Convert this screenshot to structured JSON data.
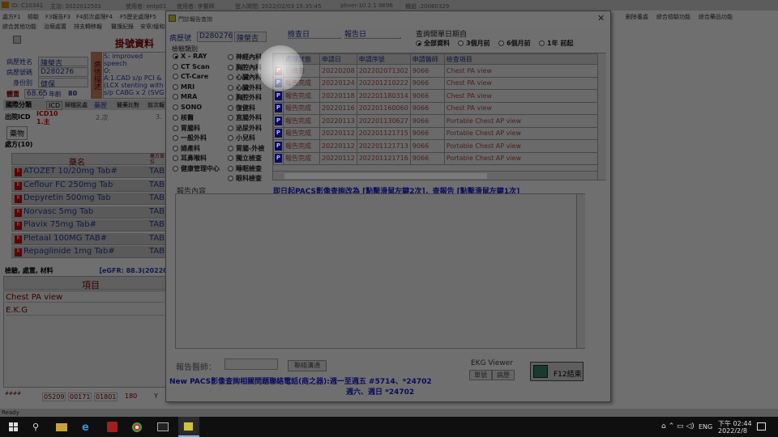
{
  "topbar": {
    "id": "ID: C10341",
    "date_label": "主治: 2022012501",
    "user": "使用者: entp01",
    "user2": "使用者: 李醫師",
    "login_time": "登入時間: 2022/02/03 15:35:45",
    "version": "pbver:10.2.1.9696",
    "machine": "機組 :20060329"
  },
  "menu": {
    "row1": [
      "處方F1",
      "檢驗",
      "F3報告F3",
      "F4前次處理F4",
      "F5歷史處理F5"
    ],
    "row1_right": [
      "刪除養處",
      "綜合檢驗功能",
      "綜合藥品功能"
    ],
    "row2": [
      "綜合其他功能",
      "治療處置",
      "排支轉移報",
      "醫護紀錄",
      "安寧/緩和"
    ]
  },
  "left": {
    "header": "掛號資料",
    "name_label": "病歷姓名",
    "name_value": "陳榮吉",
    "chart_label": "病歷號碼",
    "chart_value": "D280276",
    "id_label": "身份別",
    "id_value": "健保",
    "weight_label": "體重",
    "weight_value": "68.65",
    "age_label": "年齡",
    "age_value": "80",
    "diag_label": "病情描述",
    "diag_lines": [
      "S: improved speech",
      "O:",
      "A:1.CAD s/p PCI &",
      "(LCX stenting with",
      "s/p CABG x 2 (SVG"
    ],
    "tabs": [
      "國際分類",
      "ICD",
      "歸檔民處",
      "藥歷",
      "醫藥比對",
      "前次報"
    ],
    "icd_label": "出院ICD",
    "icd10": "ICD10",
    "icd_sub": "1.主",
    "icd_sub2": "2.次",
    "icd_sub3": "3.",
    "drug_tab": "藥物",
    "rx_title": "處方(10)",
    "drug_col": "藥名",
    "unit_col": "藥方單位",
    "drugs": [
      {
        "name": "ATOZET 10/20mg Tab#",
        "unit": "TAB"
      },
      {
        "name": "Ceflour FC 250mg Tab",
        "unit": "TAB"
      },
      {
        "name": "Depyretin 500mg Tab",
        "unit": "TAB"
      },
      {
        "name": "Norvasc 5mg Tab",
        "unit": "TAB"
      },
      {
        "name": "Plavix 75mg Tab#",
        "unit": "TAB"
      },
      {
        "name": "Pletaal 100MG TAB#",
        "unit": "TAB"
      },
      {
        "name": "Repaglinide 1mg Tab#",
        "unit": "TAB"
      }
    ],
    "exam_title": "檢驗, 處置, 材料",
    "egfr": "【eGFR: 88.3(2022012",
    "item_col": "項目",
    "items": [
      "Chest PA view",
      "E.K.G"
    ],
    "bottom_codes": [
      "####",
      "05209",
      "00171",
      "01801",
      "180",
      "Y"
    ]
  },
  "dialog": {
    "title": "門診報告查詢",
    "chart_label": "病歷號",
    "chart_value": "D280276",
    "name_value": "陳榮吉",
    "exam_date_label": "檢查日",
    "report_date_label": "報告日",
    "range_title": "查詢開單日期自",
    "ranges": [
      "全部資料",
      "3個月前",
      "6個月前",
      "1年 前起"
    ],
    "category_title": "檢驗類別",
    "categories_left": [
      "X - RAY",
      "CT Scan",
      "CT-Care",
      "MRI",
      "MRA",
      "SONO",
      "核醫",
      "胃腸科",
      "一般外科",
      "婦產科",
      "耳鼻喉科",
      "健康管理中心"
    ],
    "categories_right": [
      "神經內科",
      "胸腔內科",
      "心臟內科",
      "心臟外科",
      "胸腔外科",
      "復健科",
      "直腸外科",
      "泌尿外科",
      "小兒科",
      "胃腸-外檢",
      "獨立檢查",
      "睡眠檢查",
      "眼科檢查"
    ],
    "columns": [
      "",
      "處理狀態",
      "申請日",
      "申請序號",
      "申請醫師",
      "檢查項目"
    ],
    "rows": [
      {
        "status": "已檢查",
        "date": "20220208",
        "seq": "202202071302",
        "doc": "9066",
        "item": "Chest PA view"
      },
      {
        "status": "報告完成",
        "date": "20220124",
        "seq": "202201210222",
        "doc": "9066",
        "item": "Chest PA view"
      },
      {
        "status": "報告完成",
        "date": "20220118",
        "seq": "202201180314",
        "doc": "9066",
        "item": "Chest PA view"
      },
      {
        "status": "報告完成",
        "date": "20220116",
        "seq": "202201160060",
        "doc": "9066",
        "item": "Chest PA view"
      },
      {
        "status": "報告完成",
        "date": "20220113",
        "seq": "202201130627",
        "doc": "9066",
        "item": "Portable Chest  AP view"
      },
      {
        "status": "報告完成",
        "date": "20220112",
        "seq": "202201121715",
        "doc": "9066",
        "item": "Portable Chest  AP view"
      },
      {
        "status": "報告完成",
        "date": "20220112",
        "seq": "202201121713",
        "doc": "9066",
        "item": "Portable Chest  AP view"
      },
      {
        "status": "報告完成",
        "date": "20220112",
        "seq": "202201121716",
        "doc": "9066",
        "item": "Portable Chest  AP view"
      }
    ],
    "report_label": "報告內容",
    "pacs_hint": "即日起PACS影像查詢改為 [點擊滑鼠左鍵2次]，查報告 [點擊滑鼠左鍵1次]",
    "doctor_label": "報告醫師：",
    "contact_button": "聯絡溝通",
    "ekg_title": "EKG Viewer",
    "ekg_btn1": "單號",
    "ekg_btn2": "病歷",
    "f12_button": "F12結束",
    "notice1": "New PACS影像查詢相關問題聯絡電話(商之器):週一至週五 #5714、*24702",
    "notice2": "週六、週日 *24702"
  },
  "status_text": "Ready",
  "taskbar": {
    "lang": "ENG",
    "time": "下午 02:44",
    "date": "2022/2/8"
  }
}
